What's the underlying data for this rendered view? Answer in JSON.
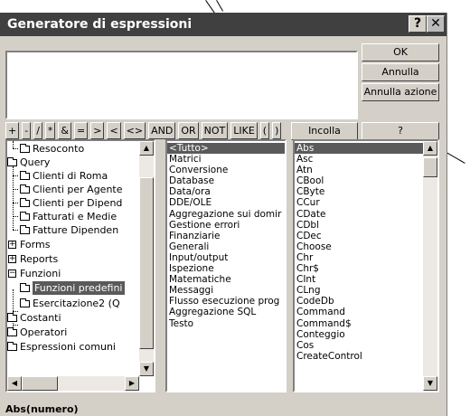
{
  "window": {
    "title": "Generatore di espressioni",
    "help_glyph": "?",
    "close_glyph": "✕"
  },
  "buttons": {
    "ok": "OK",
    "cancel": "Annulla",
    "undo": "Annulla azione",
    "paste": "Incolla",
    "help": "?"
  },
  "operators": [
    "+",
    "-",
    "/",
    "*",
    "&",
    "=",
    ">",
    "<",
    "<>",
    "AND",
    "OR",
    "NOT",
    "LIKE",
    "(",
    ")"
  ],
  "tree": [
    {
      "label": "Resoconto",
      "icon": "folder-icon"
    },
    {
      "label": "Query",
      "icon": "folder-icon"
    },
    {
      "label": "Clienti di Roma",
      "icon": "folder-icon"
    },
    {
      "label": "Clienti per Agente",
      "icon": "folder-icon"
    },
    {
      "label": "Clienti per Dipend",
      "icon": "folder-icon"
    },
    {
      "label": "Fatturati e Medie",
      "icon": "folder-icon"
    },
    {
      "label": "Fatture Dipenden",
      "icon": "folder-icon"
    },
    {
      "label": "Forms",
      "icon": "plus-box-icon"
    },
    {
      "label": "Reports",
      "icon": "plus-box-icon"
    },
    {
      "label": "Funzioni",
      "icon": "minus-box-icon"
    },
    {
      "label": "Funzioni predefini",
      "icon": "open-folder-icon"
    },
    {
      "label": "Esercitazione2 (Q",
      "icon": "folder-icon"
    },
    {
      "label": "Costanti",
      "icon": "folder-icon"
    },
    {
      "label": "Operatori",
      "icon": "folder-icon"
    },
    {
      "label": "Espressioni comuni",
      "icon": "folder-icon"
    }
  ],
  "categories": [
    "<Tutto>",
    "Matrici",
    "Conversione",
    "Database",
    "Data/ora",
    "DDE/OLE",
    "Aggregazione sui domir",
    "Gestione errori",
    "Finanziarie",
    "Generali",
    "Input/output",
    "Ispezione",
    "Matematiche",
    "Messaggi",
    "Flusso esecuzione prog",
    "Aggregazione SQL",
    "Testo"
  ],
  "functions": [
    "Abs",
    "Asc",
    "Atn",
    "CBool",
    "CByte",
    "CCur",
    "CDate",
    "CDbl",
    "CDec",
    "Choose",
    "Chr",
    "Chr$",
    "CInt",
    "CLng",
    "CodeDb",
    "Command",
    "Command$",
    "Conteggio",
    "Cos",
    "CreateControl"
  ],
  "selection": {
    "tree_item": "Funzioni predefini",
    "category": "<Tutto>",
    "function": "Abs"
  },
  "status": "Abs(numero)"
}
